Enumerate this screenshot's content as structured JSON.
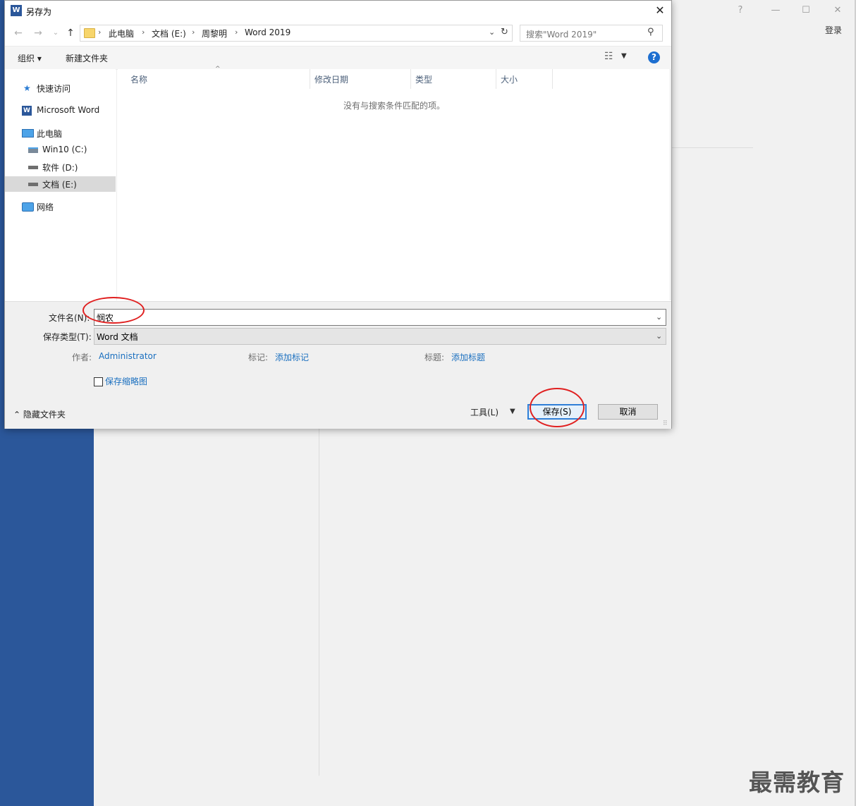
{
  "background": {
    "login_label": "登录",
    "help_glyph": "?",
    "minimize_glyph": "—",
    "restore_glyph": "☐",
    "close_glyph": "✕",
    "watermark": "最需教育",
    "sidebar_color": "#2b579a"
  },
  "dialog": {
    "title": "另存为",
    "app_icon_letter": "W",
    "close_glyph": "✕"
  },
  "nav": {
    "back_glyph": "←",
    "forward_glyph": "→",
    "recent_glyph": "⌄",
    "up_glyph": "↑",
    "breadcrumb": [
      "此电脑",
      "文档 (E:)",
      "周黎明",
      "Word 2019"
    ],
    "search_placeholder": "搜索\"Word 2019\""
  },
  "toolbar": {
    "organize_label": "组织 ▾",
    "new_folder_label": "新建文件夹"
  },
  "nav_pane": {
    "quick_access": "快速访问",
    "microsoft_word": "Microsoft Word",
    "this_pc": "此电脑",
    "drive_c": "Win10 (C:)",
    "drive_d": "软件 (D:)",
    "drive_e": "文档 (E:)",
    "network": "网络"
  },
  "file_list": {
    "columns": [
      "名称",
      "修改日期",
      "类型",
      "大小"
    ],
    "empty_message": "没有与搜索条件匹配的项。"
  },
  "form": {
    "filename_label": "文件名(N):",
    "filename_value": "悯农",
    "filetype_label": "保存类型(T):",
    "filetype_value": "Word 文档",
    "author_label": "作者:",
    "author_value": "Administrator",
    "tags_label": "标记:",
    "tags_value": "添加标记",
    "title_label": "标题:",
    "title_value": "添加标题",
    "thumbnail_label": "保存缩略图",
    "hide_folders_label": "隐藏文件夹",
    "tools_label": "工具(L)",
    "save_label": "保存(S)",
    "cancel_label": "取消"
  },
  "colors": {
    "accent": "#2f7fd7",
    "link": "#1a6fbf",
    "annotation": "#e02020"
  }
}
